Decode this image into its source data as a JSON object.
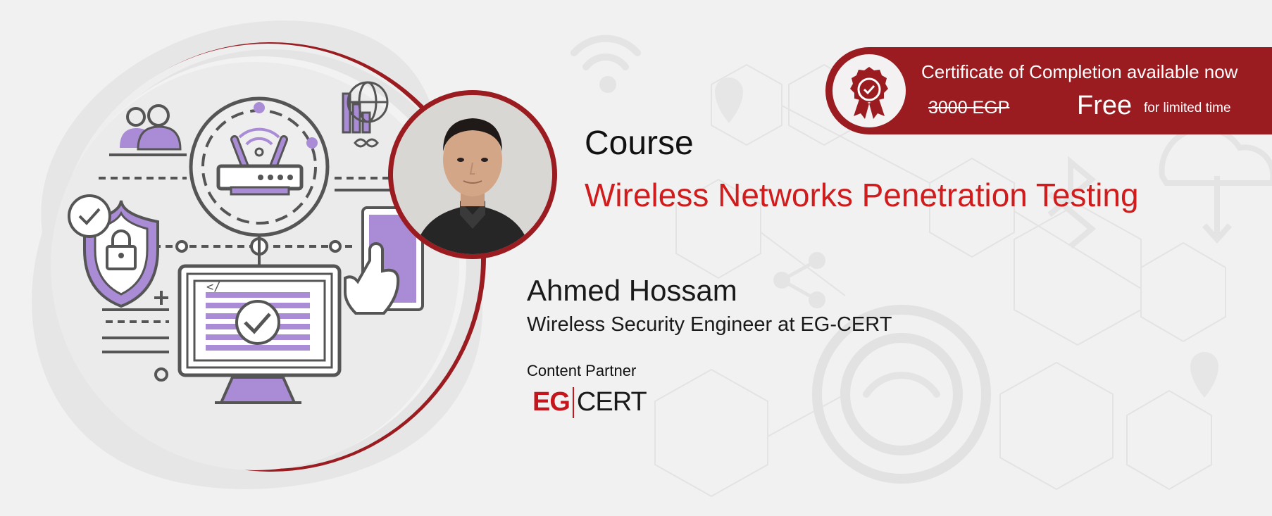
{
  "certificate": {
    "headline": "Certificate of Completion available now",
    "old_price": "3000 EGP",
    "price": "Free",
    "note": "for limited time",
    "icon": "award-ribbon-icon"
  },
  "course": {
    "label": "Course",
    "title": "Wireless Networks Penetration Testing"
  },
  "instructor": {
    "name": "Ahmed Hossam",
    "role": "Wireless Security Engineer at EG-CERT"
  },
  "partner": {
    "label": "Content Partner",
    "logo_left": "EG",
    "logo_right": "CERT"
  },
  "colors": {
    "brand_red": "#9a1b20",
    "title_red": "#d01c1c",
    "accent_purple": "#a98bd6",
    "background": "#f1f1f1"
  }
}
